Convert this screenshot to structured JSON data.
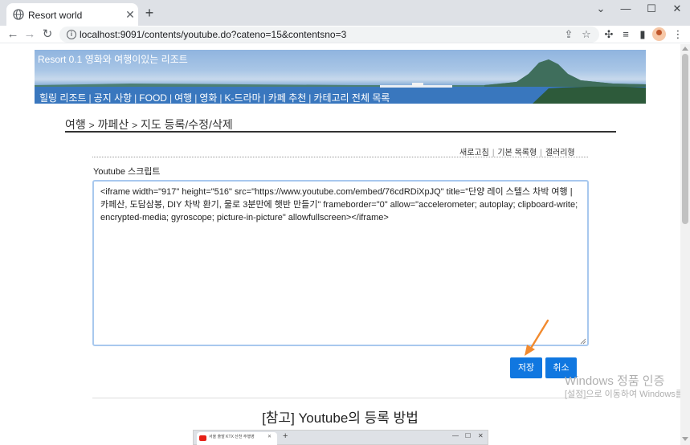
{
  "browser": {
    "tab_title": "Resort world",
    "url": "localhost:9091/contents/youtube.do?cateno=15&contentsno=3",
    "window_controls": [
      "chevron-down-icon",
      "minimize-icon",
      "maximize-icon",
      "close-icon"
    ]
  },
  "banner": {
    "title": "Resort 0.1 영화와 여행이있는 리조트",
    "menu": [
      "힐링 리조트",
      "공지 사항",
      "FOOD",
      "여행",
      "영화",
      "K-드라마",
      "카페 추천",
      "카테고리 전체 목록"
    ]
  },
  "breadcrumb": {
    "items": [
      "여행",
      "까페산",
      "지도 등록/수정/삭제"
    ],
    "separator": ">"
  },
  "view_links": [
    "새로고침",
    "기본 목록형",
    "갤러리형"
  ],
  "form": {
    "label": "Youtube 스크립트",
    "script": "<iframe width=\"917\" height=\"516\" src=\"https://www.youtube.com/embed/76cdRDiXpJQ\" title=\"단양 레이 스텔스 차박 여행 | 카페산, 도담삼봉, DIY 차박 환기, 물로 3분만에 햇반 만들기\" frameborder=\"0\" allow=\"accelerometer; autoplay; clipboard-write; encrypted-media; gyroscope; picture-in-picture\" allowfullscreen></iframe>",
    "save_label": "저장",
    "cancel_label": "취소"
  },
  "reference_title": "[참고] Youtube의 등록 방법",
  "mini_browser": {
    "tab_label": "서울 출발 KTX 산천 주행영"
  },
  "watermark": {
    "line1": "Windows 정품 인증",
    "line2": "[설정]으로 이동하여 Windows를"
  },
  "colors": {
    "accent": "#1077e0",
    "arrow": "#f28a2e",
    "banner_sky": "#8fb4df"
  }
}
